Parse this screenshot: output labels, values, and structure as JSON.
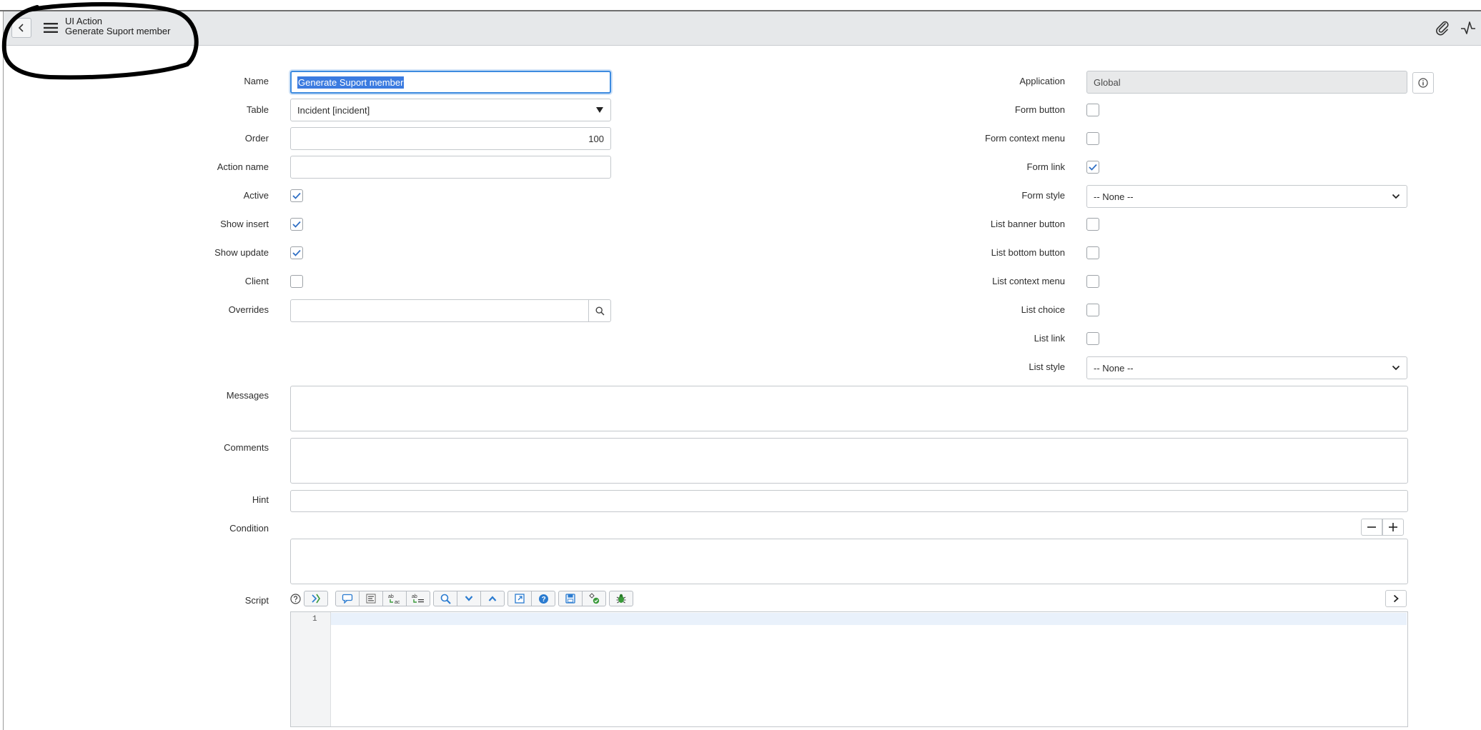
{
  "header": {
    "title": "UI Action",
    "subtitle": "Generate Suport member"
  },
  "form": {
    "left": {
      "name_label": "Name",
      "name_value": "Generate Suport member",
      "table_label": "Table",
      "table_value": "Incident [incident]",
      "order_label": "Order",
      "order_value": "100",
      "action_name_label": "Action name",
      "action_name_value": "",
      "active_label": "Active",
      "active_checked": true,
      "show_insert_label": "Show insert",
      "show_insert_checked": true,
      "show_update_label": "Show update",
      "show_update_checked": true,
      "client_label": "Client",
      "client_checked": false,
      "overrides_label": "Overrides",
      "overrides_value": ""
    },
    "right": {
      "application_label": "Application",
      "application_value": "Global",
      "form_button_label": "Form button",
      "form_button_checked": false,
      "form_context_menu_label": "Form context menu",
      "form_context_menu_checked": false,
      "form_link_label": "Form link",
      "form_link_checked": true,
      "form_style_label": "Form style",
      "form_style_value": "-- None --",
      "list_banner_button_label": "List banner button",
      "list_banner_button_checked": false,
      "list_bottom_button_label": "List bottom button",
      "list_bottom_button_checked": false,
      "list_context_menu_label": "List context menu",
      "list_context_menu_checked": false,
      "list_choice_label": "List choice",
      "list_choice_checked": false,
      "list_link_label": "List link",
      "list_link_checked": false,
      "list_style_label": "List style",
      "list_style_value": "-- None --"
    },
    "wide": {
      "messages_label": "Messages",
      "comments_label": "Comments",
      "hint_label": "Hint",
      "condition_label": "Condition",
      "script_label": "Script"
    },
    "script": {
      "line_numbers": [
        "1"
      ]
    }
  },
  "colors": {
    "accent": "#3d8be0",
    "header_bg": "#e6e8ea",
    "checkbox_check": "#2f6fc4"
  }
}
